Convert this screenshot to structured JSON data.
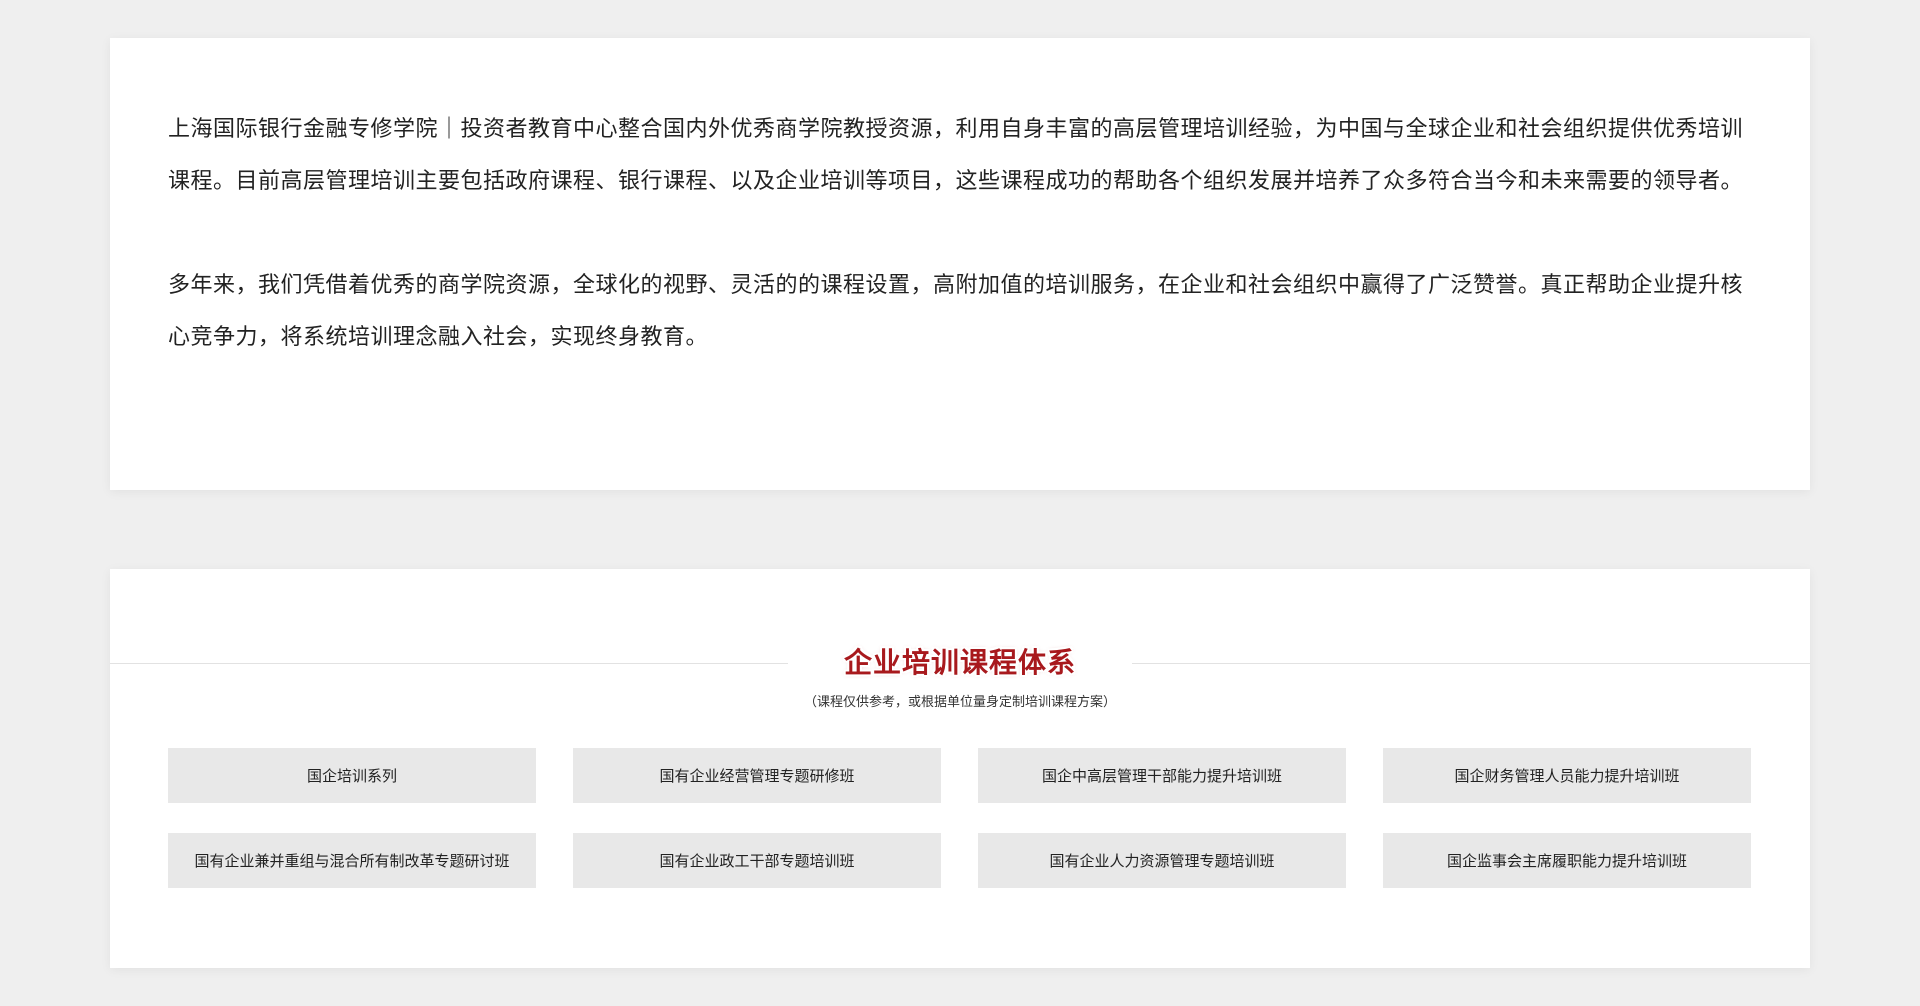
{
  "intro": {
    "paragraphs": [
      "上海国际银行金融专修学院｜投资者教育中心整合国内外优秀商学院教授资源，利用自身丰富的高层管理培训经验，为中国与全球企业和社会组织提供优秀培训课程。目前高层管理培训主要包括政府课程、银行课程、以及企业培训等项目，这些课程成功的帮助各个组织发展并培养了众多符合当今和未来需要的领导者。",
      "多年来，我们凭借着优秀的商学院资源，全球化的视野、灵活的的课程设置，高附加值的培训服务，在企业和社会组织中赢得了广泛赞誉。真正帮助企业提升核心竞争力，将系统培训理念融入社会，实现终身教育。"
    ]
  },
  "courses": {
    "title": "企业培训课程体系",
    "subtitle": "（课程仅供参考，或根据单位量身定制培训课程方案）",
    "items": [
      "国企培训系列",
      "国有企业经营管理专题研修班",
      "国企中高层管理干部能力提升培训班",
      "国企财务管理人员能力提升培训班",
      "国有企业兼并重组与混合所有制改革专题研讨班",
      "国有企业政工干部专题培训班",
      "国有企业人力资源管理专题培训班",
      "国企监事会主席履职能力提升培训班"
    ]
  },
  "colors": {
    "accent": "#a8191d",
    "background": "#efefef",
    "card": "#ffffff",
    "course_item_bg": "#e8e8e8"
  }
}
